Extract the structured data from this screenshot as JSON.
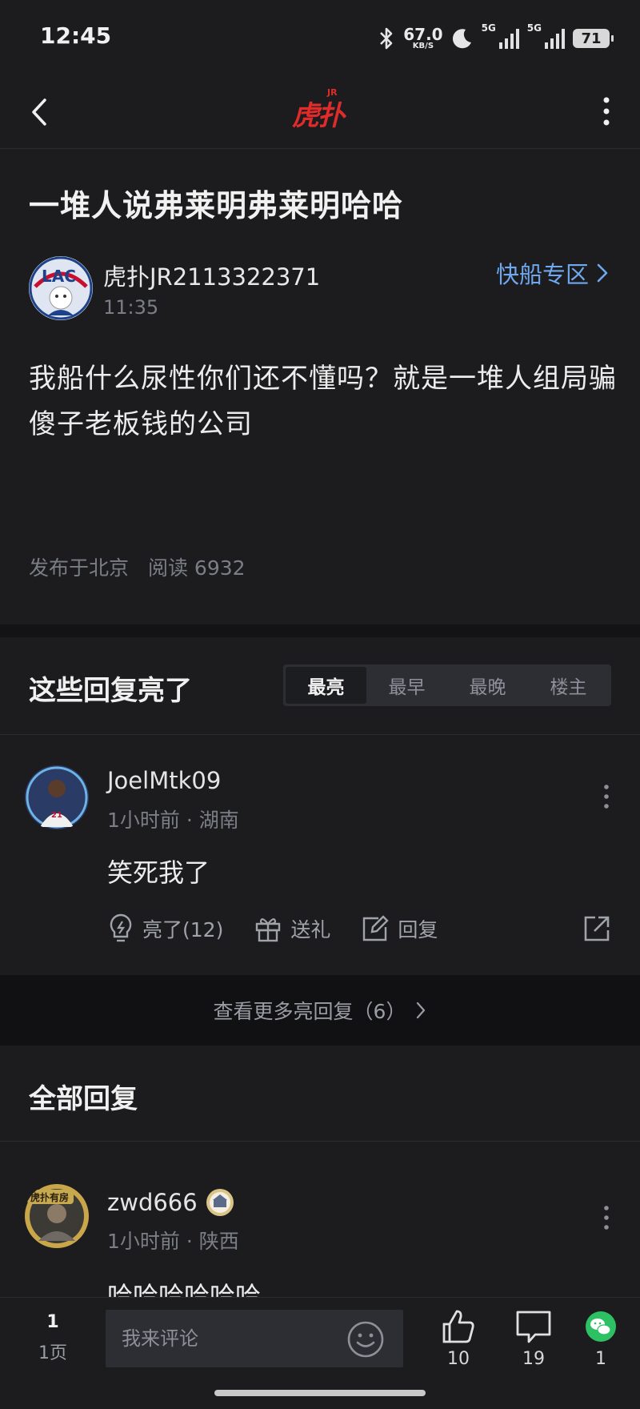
{
  "status_bar": {
    "time": "12:45",
    "net_speed": "67.0",
    "net_unit": "KB/S",
    "sig1": "5G",
    "sig2": "5G",
    "battery": "71"
  },
  "header": {
    "logo_text": "虎扑",
    "logo_badge": "JR"
  },
  "post": {
    "title": "一堆人说弗莱明弗莱明哈哈",
    "author": "虎扑JR2113322371",
    "time": "11:35",
    "zone_label": "快船专区",
    "content": "我船什么尿性你们还不懂吗？就是一堆人组局骗傻子老板钱的公司",
    "location": "发布于北京",
    "read_label": "阅读 6932"
  },
  "lit_section": {
    "title": "这些回复亮了",
    "tabs": [
      "最亮",
      "最早",
      "最晚",
      "楼主"
    ],
    "active_tab": 0
  },
  "lit_reply": {
    "user": "JoelMtk09",
    "time": "1小时前",
    "location": "湖南",
    "content": "笑死我了",
    "light_label": "亮了(12)",
    "gift_label": "送礼",
    "reply_label": "回复"
  },
  "more_lit_label": "查看更多亮回复（6）",
  "all_section": {
    "title": "全部回复"
  },
  "reply": {
    "user": "zwd666",
    "time": "1小时前",
    "location": "陕西",
    "content": "哈哈哈哈哈哈"
  },
  "bottom_bar": {
    "page_current": "1",
    "page_label": "1页",
    "input_placeholder": "我来评论",
    "like_count": "10",
    "comment_count": "19",
    "share_count": "1"
  },
  "colors": {
    "background": "#1c1c1e",
    "accent_link": "#6fa8ef",
    "logo_red": "#e02b2b",
    "wechat_green": "#2dc163"
  }
}
